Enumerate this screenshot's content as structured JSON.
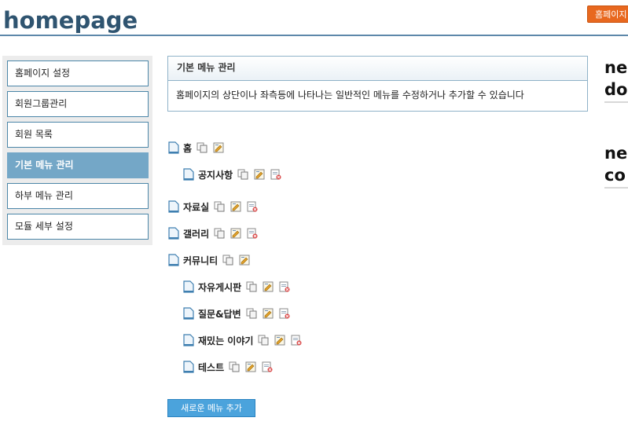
{
  "header": {
    "title": "homepage",
    "top_button_label": "홈페이지"
  },
  "sidebar": {
    "items": [
      {
        "label": "홈페이지 설정",
        "active": false
      },
      {
        "label": "회원그룹관리",
        "active": false
      },
      {
        "label": "회원 목록",
        "active": false
      },
      {
        "label": "기본 메뉴 관리",
        "active": true
      },
      {
        "label": "하부 메뉴 관리",
        "active": false
      },
      {
        "label": "모듈 세부 설정",
        "active": false
      }
    ]
  },
  "info_box": {
    "title": "기본 메뉴 관리",
    "description": "홈페이지의 상단이나 좌측등에 나타나는 일반적인 메뉴를 수정하거나 추가할 수 있습니다"
  },
  "menu_tree": [
    {
      "label": "홈",
      "level": 0,
      "icons": [
        "copy-icon",
        "edit-icon"
      ]
    },
    {
      "label": "공지사항",
      "level": 1,
      "icons": [
        "copy-icon",
        "edit-icon",
        "delete-icon"
      ]
    },
    {
      "label": "자료실",
      "level": 0,
      "icons": [
        "copy-icon",
        "edit-icon",
        "delete-icon"
      ]
    },
    {
      "label": "갤러리",
      "level": 0,
      "icons": [
        "copy-icon",
        "edit-icon",
        "delete-icon"
      ]
    },
    {
      "label": "커뮤니티",
      "level": 0,
      "icons": [
        "copy-icon",
        "edit-icon"
      ]
    },
    {
      "label": "자유게시판",
      "level": 1,
      "icons": [
        "copy-icon",
        "edit-icon",
        "delete-icon"
      ]
    },
    {
      "label": "질문&답변",
      "level": 1,
      "icons": [
        "copy-icon",
        "edit-icon",
        "delete-icon"
      ]
    },
    {
      "label": "재밌는 이야기",
      "level": 1,
      "icons": [
        "copy-icon",
        "edit-icon",
        "delete-icon"
      ]
    },
    {
      "label": "테스트",
      "level": 1,
      "icons": [
        "copy-icon",
        "edit-icon",
        "delete-icon"
      ]
    }
  ],
  "add_menu_button_label": "새로운 메뉴 추가",
  "right_panel": {
    "heading1_line1": "new",
    "heading1_line2": "do",
    "heading2_line1": "new",
    "heading2_line2": "co"
  },
  "colors": {
    "title": "#2f5470",
    "accent_blue": "#74a7c7",
    "top_button": "#e8681f",
    "add_button": "#4ba3dc"
  }
}
